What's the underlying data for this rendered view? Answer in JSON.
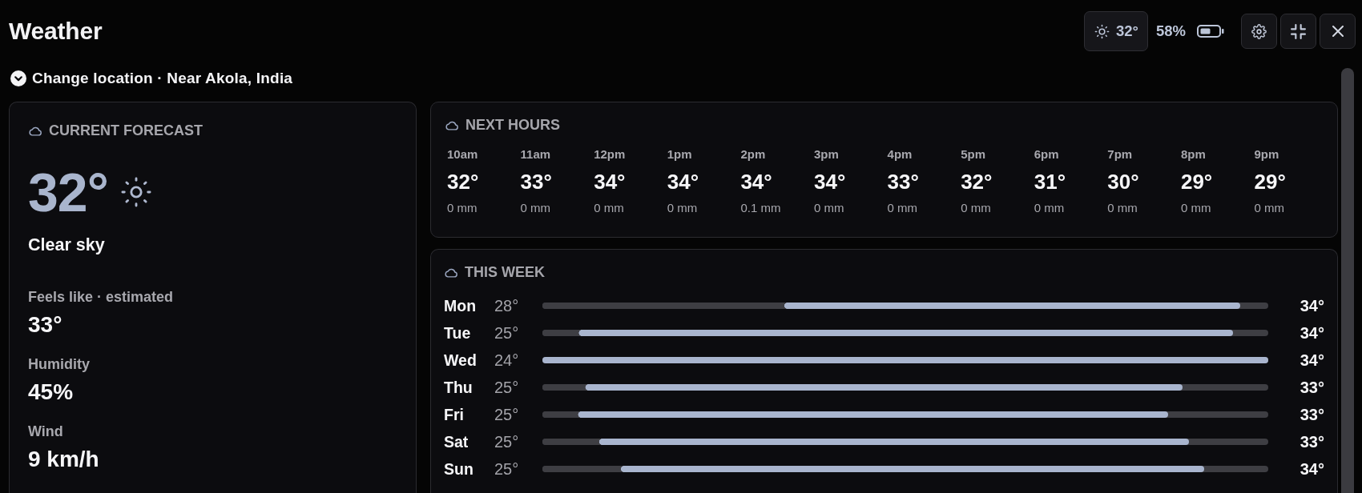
{
  "window": {
    "title": "Weather"
  },
  "toolbar": {
    "weather_temperature": "32°",
    "battery": "58%"
  },
  "location": {
    "label": "Change location · Near Akola, India"
  },
  "current_forecast": {
    "title": "CURRENT FORECAST",
    "temperature": "32°",
    "condition": "Clear sky",
    "details": [
      {
        "label": "Feels like · estimated",
        "value": "33°"
      },
      {
        "label": "Humidity",
        "value": "45%"
      },
      {
        "label": "Wind",
        "value": "9 km/h"
      }
    ]
  },
  "next_hours": {
    "title": "NEXT HOURS",
    "hours": [
      {
        "time": "10am",
        "temperature": "32°",
        "precipitation": "0 mm"
      },
      {
        "time": "11am",
        "temperature": "33°",
        "precipitation": "0 mm"
      },
      {
        "time": "12pm",
        "temperature": "34°",
        "precipitation": "0 mm"
      },
      {
        "time": "1pm",
        "temperature": "34°",
        "precipitation": "0 mm"
      },
      {
        "time": "2pm",
        "temperature": "34°",
        "precipitation": "0.1 mm"
      },
      {
        "time": "3pm",
        "temperature": "34°",
        "precipitation": "0 mm"
      },
      {
        "time": "4pm",
        "temperature": "33°",
        "precipitation": "0 mm"
      },
      {
        "time": "5pm",
        "temperature": "32°",
        "precipitation": "0 mm"
      },
      {
        "time": "6pm",
        "temperature": "31°",
        "precipitation": "0 mm"
      },
      {
        "time": "7pm",
        "temperature": "30°",
        "precipitation": "0 mm"
      },
      {
        "time": "8pm",
        "temperature": "29°",
        "precipitation": "0 mm"
      },
      {
        "time": "9pm",
        "temperature": "29°",
        "precipitation": "0 mm"
      }
    ]
  },
  "this_week": {
    "title": "THIS WEEK",
    "days": [
      {
        "day": "Mon",
        "low": "28°",
        "high": "34°",
        "bar": {
          "start": {
            "level": 0.333
          },
          "end": {
            "level": 0.961
          }
        }
      },
      {
        "day": "Tue",
        "low": "25°",
        "high": "34°",
        "bar": {
          "start": {
            "level": 0.05
          },
          "end": {
            "level": 0.951
          }
        }
      },
      {
        "day": "Wed",
        "low": "24°",
        "high": "34°",
        "bar": {
          "end": {
            "level": 1
          }
        }
      },
      {
        "day": "Thu",
        "low": "25°",
        "high": "33°",
        "bar": {
          "start": {
            "level": 0.059
          },
          "end": {
            "level": 0.882
          }
        }
      },
      {
        "day": "Fri",
        "low": "25°",
        "high": "33°",
        "bar": {
          "start": {
            "level": 0.049
          },
          "end": {
            "level": 0.862
          }
        }
      },
      {
        "day": "Sat",
        "low": "25°",
        "high": "33°",
        "bar": {
          "start": {
            "level": 0.078
          },
          "end": {
            "level": 0.891
          }
        }
      },
      {
        "day": "Sun",
        "low": "25°",
        "high": "34°",
        "bar": {
          "start": {
            "level": 0.108
          },
          "end": {
            "level": 0.912
          }
        }
      }
    ]
  }
}
